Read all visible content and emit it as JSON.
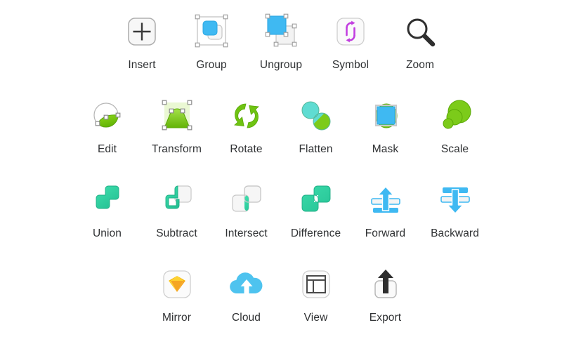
{
  "palette": {
    "background": "#ffffff",
    "label_text": "#2f3133",
    "blue": "#35b7f3",
    "blue_dark": "#1ea7e4",
    "green": "#78cc15",
    "green_dark": "#5fae08",
    "teal": "#2ed6a3",
    "teal_dark": "#23b98c",
    "cyan": "#5fdcd2",
    "purple": "#c23ee0",
    "gray_fill": "#f4f4f4",
    "gray_stroke": "#b9b9b9",
    "dark_stroke": "#3c3c3c",
    "sketch_gold": "#f7b500",
    "sketch_gold_light": "#fdd231"
  },
  "rows": [
    {
      "name": "row-1",
      "items": [
        {
          "label": "Insert",
          "icon": "plus-in-rounded-square-icon"
        },
        {
          "label": "Group",
          "icon": "group-selection-icon"
        },
        {
          "label": "Ungroup",
          "icon": "ungroup-selection-icon"
        },
        {
          "label": "Symbol",
          "icon": "symbol-sync-arrows-icon"
        },
        {
          "label": "Zoom",
          "icon": "magnifier-icon"
        }
      ]
    },
    {
      "name": "row-2",
      "items": [
        {
          "label": "Edit",
          "icon": "edit-vector-points-icon"
        },
        {
          "label": "Transform",
          "icon": "transform-shape-icon"
        },
        {
          "label": "Rotate",
          "icon": "rotate-arrows-icon"
        },
        {
          "label": "Flatten",
          "icon": "flatten-shapes-icon"
        },
        {
          "label": "Mask",
          "icon": "mask-square-circle-icon"
        },
        {
          "label": "Scale",
          "icon": "scale-circles-icon"
        }
      ]
    },
    {
      "name": "row-3",
      "items": [
        {
          "label": "Union",
          "icon": "union-squares-icon"
        },
        {
          "label": "Subtract",
          "icon": "subtract-squares-icon"
        },
        {
          "label": "Intersect",
          "icon": "intersect-squares-icon"
        },
        {
          "label": "Difference",
          "icon": "difference-squares-icon"
        },
        {
          "label": "Forward",
          "icon": "bring-forward-arrow-icon"
        },
        {
          "label": "Backward",
          "icon": "send-backward-arrow-icon"
        }
      ]
    },
    {
      "name": "row-4",
      "items": [
        {
          "label": "Mirror",
          "icon": "sketch-diamond-icon"
        },
        {
          "label": "Cloud",
          "icon": "cloud-upload-icon"
        },
        {
          "label": "View",
          "icon": "view-layout-icon"
        },
        {
          "label": "Export",
          "icon": "export-up-arrow-icon"
        }
      ]
    }
  ]
}
